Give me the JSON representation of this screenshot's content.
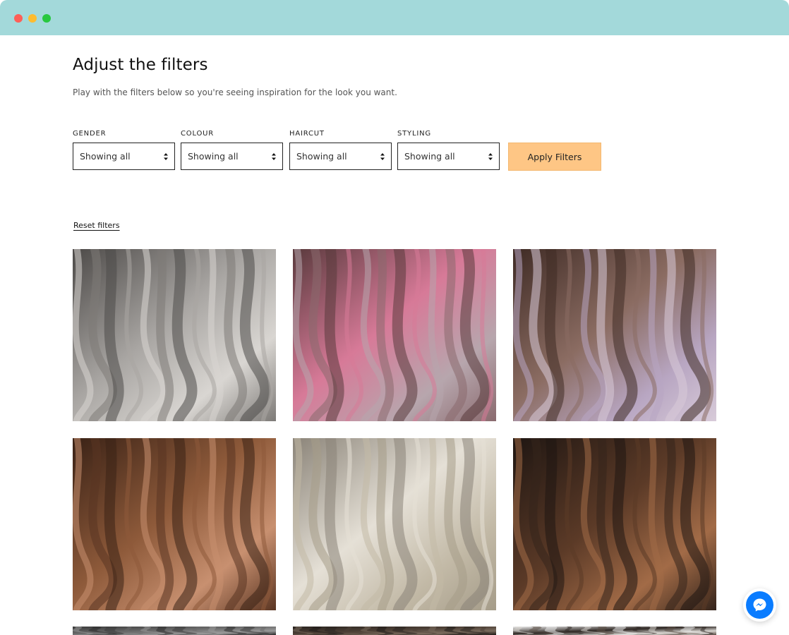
{
  "header": {
    "title": "Adjust the filters",
    "subtitle": "Play with the filters below so you're seeing inspiration for the look you want."
  },
  "filters": [
    {
      "label": "GENDER",
      "value": "Showing all"
    },
    {
      "label": "COLOUR",
      "value": "Showing all"
    },
    {
      "label": "HAIRCUT",
      "value": "Showing all"
    },
    {
      "label": "STYLING",
      "value": "Showing all"
    }
  ],
  "apply_label": "Apply Filters",
  "reset_label": "Reset filters",
  "colors": {
    "titlebar": "#a3d9da",
    "apply_button": "#fec685",
    "messenger": "#0a7cff"
  },
  "gallery": [
    {
      "name": "silver-balayage-hair-photo",
      "palette": [
        "#4d4a48",
        "#a9a6a3",
        "#d9d6d2",
        "#7d7a77"
      ]
    },
    {
      "name": "pink-highlights-hair-photo",
      "palette": [
        "#5a3a3d",
        "#d77a98",
        "#b7a6ad",
        "#8a6a6e"
      ]
    },
    {
      "name": "lilac-balayage-bob-photo",
      "palette": [
        "#3f2b25",
        "#8b6c62",
        "#b8a6c2",
        "#d8cbd9"
      ]
    },
    {
      "name": "copper-waves-hair-photo",
      "palette": [
        "#3a2216",
        "#8e5a3a",
        "#c89070",
        "#5a3522"
      ]
    },
    {
      "name": "blonde-waves-hair-photo",
      "palette": [
        "#8b8479",
        "#e5e0d6",
        "#c2b9a6",
        "#a59c89"
      ]
    },
    {
      "name": "brunette-bob-hair-photo",
      "palette": [
        "#1f1612",
        "#5b3a27",
        "#a26b47",
        "#34241b"
      ]
    },
    {
      "name": "hair-photo-row3-1",
      "palette": [
        "#3a3a3a",
        "#6b6b6b",
        "#9a9a9a",
        "#2a2a2a"
      ]
    },
    {
      "name": "hair-photo-row3-2",
      "palette": [
        "#2a2420",
        "#4d4036",
        "#7a6b5d",
        "#1e1a17"
      ]
    },
    {
      "name": "hair-photo-row3-3",
      "palette": [
        "#eeeeee",
        "#2f2824",
        "#d8d5d0",
        "#5b4e45"
      ]
    }
  ]
}
